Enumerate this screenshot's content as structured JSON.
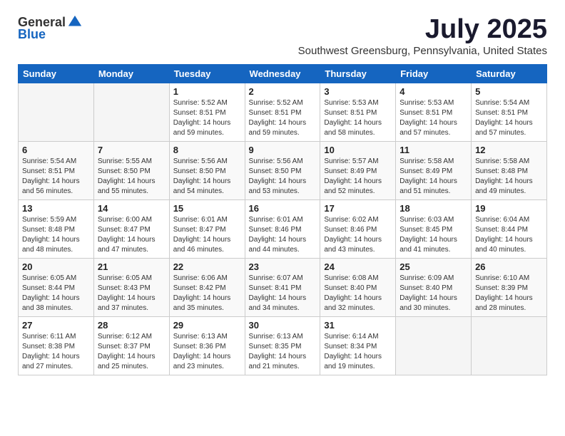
{
  "logo": {
    "general": "General",
    "blue": "Blue"
  },
  "title": "July 2025",
  "subtitle": "Southwest Greensburg, Pennsylvania, United States",
  "days_of_week": [
    "Sunday",
    "Monday",
    "Tuesday",
    "Wednesday",
    "Thursday",
    "Friday",
    "Saturday"
  ],
  "weeks": [
    [
      {
        "day": "",
        "info": ""
      },
      {
        "day": "",
        "info": ""
      },
      {
        "day": "1",
        "info": "Sunrise: 5:52 AM\nSunset: 8:51 PM\nDaylight: 14 hours\nand 59 minutes."
      },
      {
        "day": "2",
        "info": "Sunrise: 5:52 AM\nSunset: 8:51 PM\nDaylight: 14 hours\nand 59 minutes."
      },
      {
        "day": "3",
        "info": "Sunrise: 5:53 AM\nSunset: 8:51 PM\nDaylight: 14 hours\nand 58 minutes."
      },
      {
        "day": "4",
        "info": "Sunrise: 5:53 AM\nSunset: 8:51 PM\nDaylight: 14 hours\nand 57 minutes."
      },
      {
        "day": "5",
        "info": "Sunrise: 5:54 AM\nSunset: 8:51 PM\nDaylight: 14 hours\nand 57 minutes."
      }
    ],
    [
      {
        "day": "6",
        "info": "Sunrise: 5:54 AM\nSunset: 8:51 PM\nDaylight: 14 hours\nand 56 minutes."
      },
      {
        "day": "7",
        "info": "Sunrise: 5:55 AM\nSunset: 8:50 PM\nDaylight: 14 hours\nand 55 minutes."
      },
      {
        "day": "8",
        "info": "Sunrise: 5:56 AM\nSunset: 8:50 PM\nDaylight: 14 hours\nand 54 minutes."
      },
      {
        "day": "9",
        "info": "Sunrise: 5:56 AM\nSunset: 8:50 PM\nDaylight: 14 hours\nand 53 minutes."
      },
      {
        "day": "10",
        "info": "Sunrise: 5:57 AM\nSunset: 8:49 PM\nDaylight: 14 hours\nand 52 minutes."
      },
      {
        "day": "11",
        "info": "Sunrise: 5:58 AM\nSunset: 8:49 PM\nDaylight: 14 hours\nand 51 minutes."
      },
      {
        "day": "12",
        "info": "Sunrise: 5:58 AM\nSunset: 8:48 PM\nDaylight: 14 hours\nand 49 minutes."
      }
    ],
    [
      {
        "day": "13",
        "info": "Sunrise: 5:59 AM\nSunset: 8:48 PM\nDaylight: 14 hours\nand 48 minutes."
      },
      {
        "day": "14",
        "info": "Sunrise: 6:00 AM\nSunset: 8:47 PM\nDaylight: 14 hours\nand 47 minutes."
      },
      {
        "day": "15",
        "info": "Sunrise: 6:01 AM\nSunset: 8:47 PM\nDaylight: 14 hours\nand 46 minutes."
      },
      {
        "day": "16",
        "info": "Sunrise: 6:01 AM\nSunset: 8:46 PM\nDaylight: 14 hours\nand 44 minutes."
      },
      {
        "day": "17",
        "info": "Sunrise: 6:02 AM\nSunset: 8:46 PM\nDaylight: 14 hours\nand 43 minutes."
      },
      {
        "day": "18",
        "info": "Sunrise: 6:03 AM\nSunset: 8:45 PM\nDaylight: 14 hours\nand 41 minutes."
      },
      {
        "day": "19",
        "info": "Sunrise: 6:04 AM\nSunset: 8:44 PM\nDaylight: 14 hours\nand 40 minutes."
      }
    ],
    [
      {
        "day": "20",
        "info": "Sunrise: 6:05 AM\nSunset: 8:44 PM\nDaylight: 14 hours\nand 38 minutes."
      },
      {
        "day": "21",
        "info": "Sunrise: 6:05 AM\nSunset: 8:43 PM\nDaylight: 14 hours\nand 37 minutes."
      },
      {
        "day": "22",
        "info": "Sunrise: 6:06 AM\nSunset: 8:42 PM\nDaylight: 14 hours\nand 35 minutes."
      },
      {
        "day": "23",
        "info": "Sunrise: 6:07 AM\nSunset: 8:41 PM\nDaylight: 14 hours\nand 34 minutes."
      },
      {
        "day": "24",
        "info": "Sunrise: 6:08 AM\nSunset: 8:40 PM\nDaylight: 14 hours\nand 32 minutes."
      },
      {
        "day": "25",
        "info": "Sunrise: 6:09 AM\nSunset: 8:40 PM\nDaylight: 14 hours\nand 30 minutes."
      },
      {
        "day": "26",
        "info": "Sunrise: 6:10 AM\nSunset: 8:39 PM\nDaylight: 14 hours\nand 28 minutes."
      }
    ],
    [
      {
        "day": "27",
        "info": "Sunrise: 6:11 AM\nSunset: 8:38 PM\nDaylight: 14 hours\nand 27 minutes."
      },
      {
        "day": "28",
        "info": "Sunrise: 6:12 AM\nSunset: 8:37 PM\nDaylight: 14 hours\nand 25 minutes."
      },
      {
        "day": "29",
        "info": "Sunrise: 6:13 AM\nSunset: 8:36 PM\nDaylight: 14 hours\nand 23 minutes."
      },
      {
        "day": "30",
        "info": "Sunrise: 6:13 AM\nSunset: 8:35 PM\nDaylight: 14 hours\nand 21 minutes."
      },
      {
        "day": "31",
        "info": "Sunrise: 6:14 AM\nSunset: 8:34 PM\nDaylight: 14 hours\nand 19 minutes."
      },
      {
        "day": "",
        "info": ""
      },
      {
        "day": "",
        "info": ""
      }
    ]
  ]
}
